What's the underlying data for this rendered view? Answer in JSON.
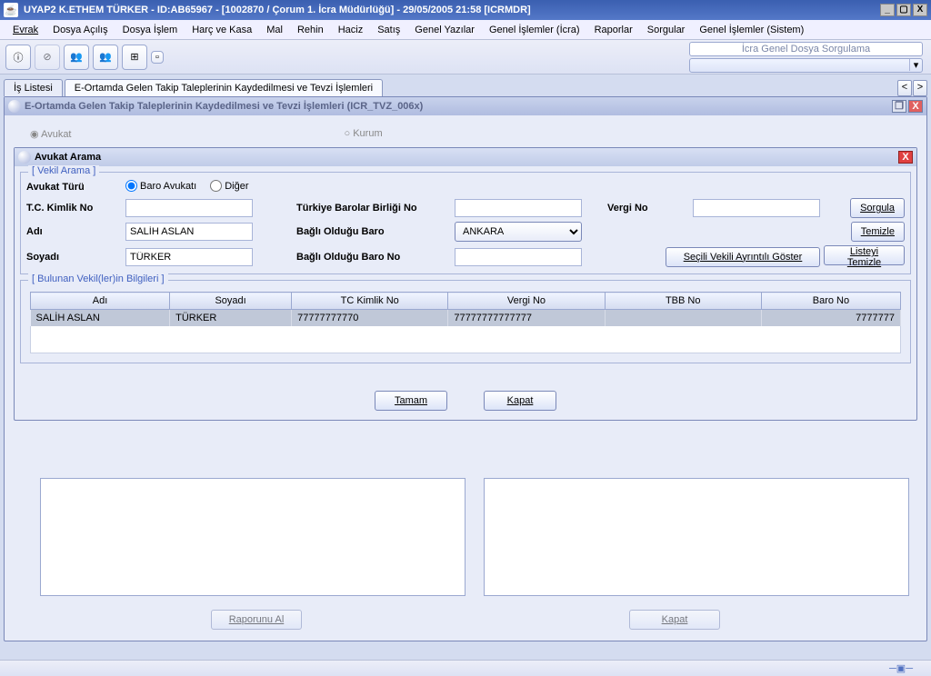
{
  "title": "UYAP2   K.ETHEM TÜRKER - ID:AB65967 - [1002870 / Çorum 1. İcra Müdürlüğü] - 29/05/2005 21:58 [ICRMDR]",
  "menus": [
    "Evrak",
    "Dosya Açılış",
    "Dosya İşlem",
    "Harç ve Kasa",
    "Mal",
    "Rehin",
    "Haciz",
    "Satış",
    "Genel Yazılar",
    "Genel İşlemler (İcra)",
    "Raporlar",
    "Sorgular",
    "Genel İşlemler (Sistem)"
  ],
  "toolbar_combo": "İcra Genel Dosya Sorgulama",
  "tabs": {
    "t1": "İş Listesi",
    "t2": "E-Ortamda Gelen Takip Taleplerinin Kaydedilmesi ve Tevzi İşlemleri"
  },
  "win_title": "E-Ortamda Gelen Takip Taleplerinin Kaydedilmesi ve Tevzi İşlemleri (ICR_TVZ_006x)",
  "radio_avukat": "Avukat",
  "radio_kurum": "Kurum",
  "inner_title": "Avukat Arama",
  "fs1_legend": "[ Vekil Arama ]",
  "labels": {
    "avukat_turu": "Avukat Türü",
    "baro_avukati": "Baro Avukatı",
    "diger": "Diğer",
    "tc": "T.C. Kimlik No",
    "adi": "Adı",
    "soyadi": "Soyadı",
    "tbb": "Türkiye Barolar Birliği No",
    "bagli_baro": "Bağlı Olduğu Baro",
    "bagli_baro_no": "Bağlı Olduğu Baro No",
    "vergi": "Vergi No"
  },
  "values": {
    "tc": "",
    "adi": "SALİH ASLAN",
    "soyadi": "TÜRKER",
    "tbb": "",
    "baro_select": "ANKARA",
    "baro_no": "",
    "vergi": ""
  },
  "buttons": {
    "sorgula": "Sorgula",
    "temizle": "Temizle",
    "secili": "Seçili Vekili Ayrıntılı Göster",
    "listeyi": "Listeyi Temizle",
    "tamam": "Tamam",
    "kapat": "Kapat",
    "raporunu": "Raporunu Al",
    "kapat2": "Kapat"
  },
  "fs2_legend": "[ Bulunan Vekil(ler)in Bilgileri ]",
  "columns": [
    "Adı",
    "Soyadı",
    "TC Kimlik No",
    "Vergi No",
    "TBB No",
    "Baro No"
  ],
  "row": {
    "adi": "SALİH ASLAN",
    "soyadi": "TÜRKER",
    "tc": "77777777770",
    "vergi": "77777777777777",
    "tbb": "",
    "baro": "7777777"
  }
}
